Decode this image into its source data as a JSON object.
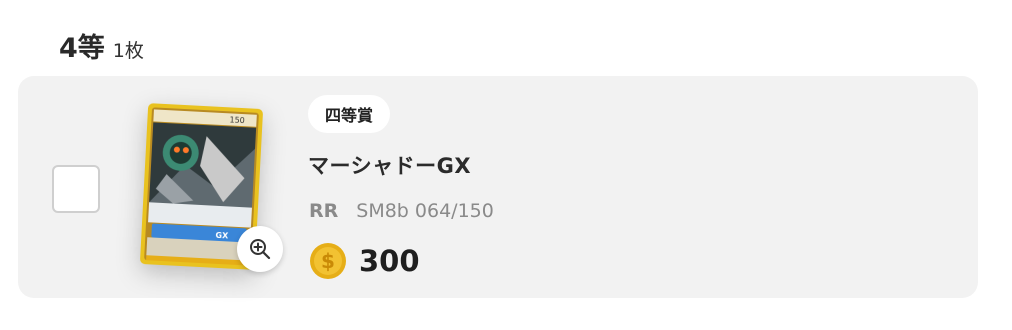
{
  "section": {
    "rank_title": "4等",
    "count_label": "1枚"
  },
  "prize": {
    "badge_label": "四等賞",
    "card_name": "マーシャドーGX",
    "rarity": "RR",
    "set_number": "SM8b 064/150",
    "price": "300",
    "hp": "150",
    "attack_label": "GX"
  },
  "icons": {
    "coin": "coin-icon",
    "zoom": "zoom-in-icon",
    "checkbox": "checkbox-unchecked"
  },
  "colors": {
    "row_background": "#f2f2f2",
    "coin_gold": "#e6ae17",
    "meta_gray": "#8a8a8a"
  }
}
